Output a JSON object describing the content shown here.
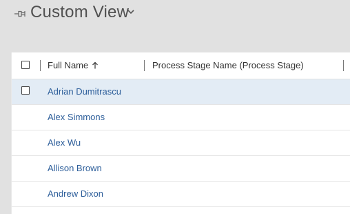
{
  "view": {
    "title": "Custom View",
    "pin_icon": "pin-icon",
    "chevron_icon": "chevron-down-icon"
  },
  "grid": {
    "columns": [
      {
        "label": "Full Name",
        "sort": "ascending",
        "sort_icon": "arrow-up-icon"
      },
      {
        "label": "Process Stage Name (Process Stage)"
      }
    ],
    "rows": [
      {
        "full_name": "Adrian Dumitrascu",
        "selected": true,
        "show_checkbox": true
      },
      {
        "full_name": "Alex Simmons"
      },
      {
        "full_name": "Alex Wu"
      },
      {
        "full_name": "Allison Brown"
      },
      {
        "full_name": "Andrew Dixon"
      }
    ]
  },
  "colors": {
    "link": "#2d5e9a",
    "selected_row": "#e3ecf5",
    "header_bar": "#e1e1e1"
  }
}
